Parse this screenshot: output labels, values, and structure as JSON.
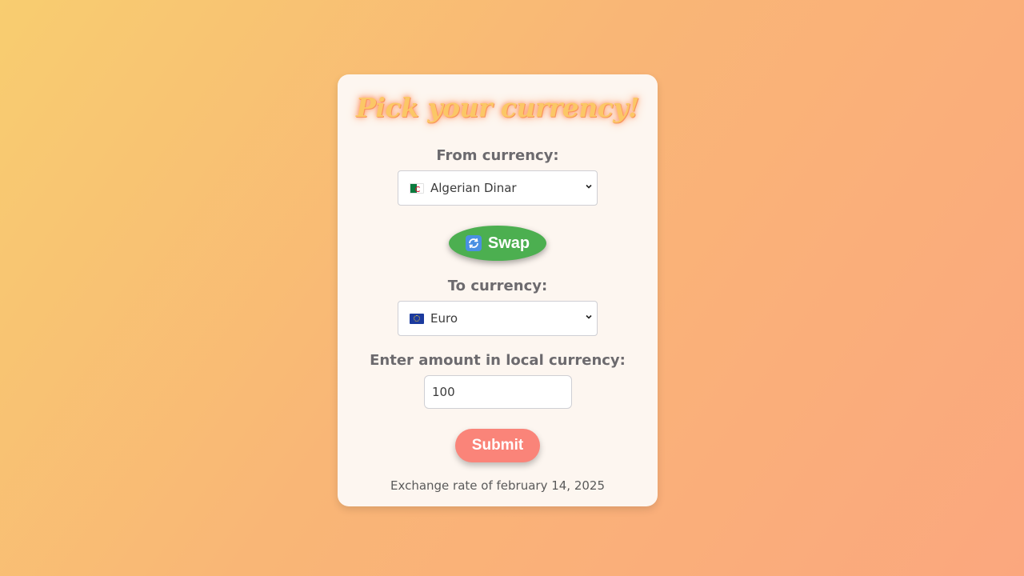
{
  "title": "Pick your currency!",
  "from": {
    "label": "From currency:",
    "selected": "Algerian Dinar",
    "flag_icon": "flag-algeria-icon"
  },
  "swap": {
    "label": "Swap",
    "icon": "swap-arrows-icon"
  },
  "to": {
    "label": "To currency:",
    "selected": "Euro",
    "flag_icon": "flag-eu-icon"
  },
  "amount": {
    "label": "Enter amount in local currency:",
    "value": "100"
  },
  "submit": {
    "label": "Submit"
  },
  "footer": "Exchange rate of february 14, 2025",
  "colors": {
    "swap_button": "#4caf50",
    "submit_button": "#fa8479",
    "title": "#fbc766"
  }
}
